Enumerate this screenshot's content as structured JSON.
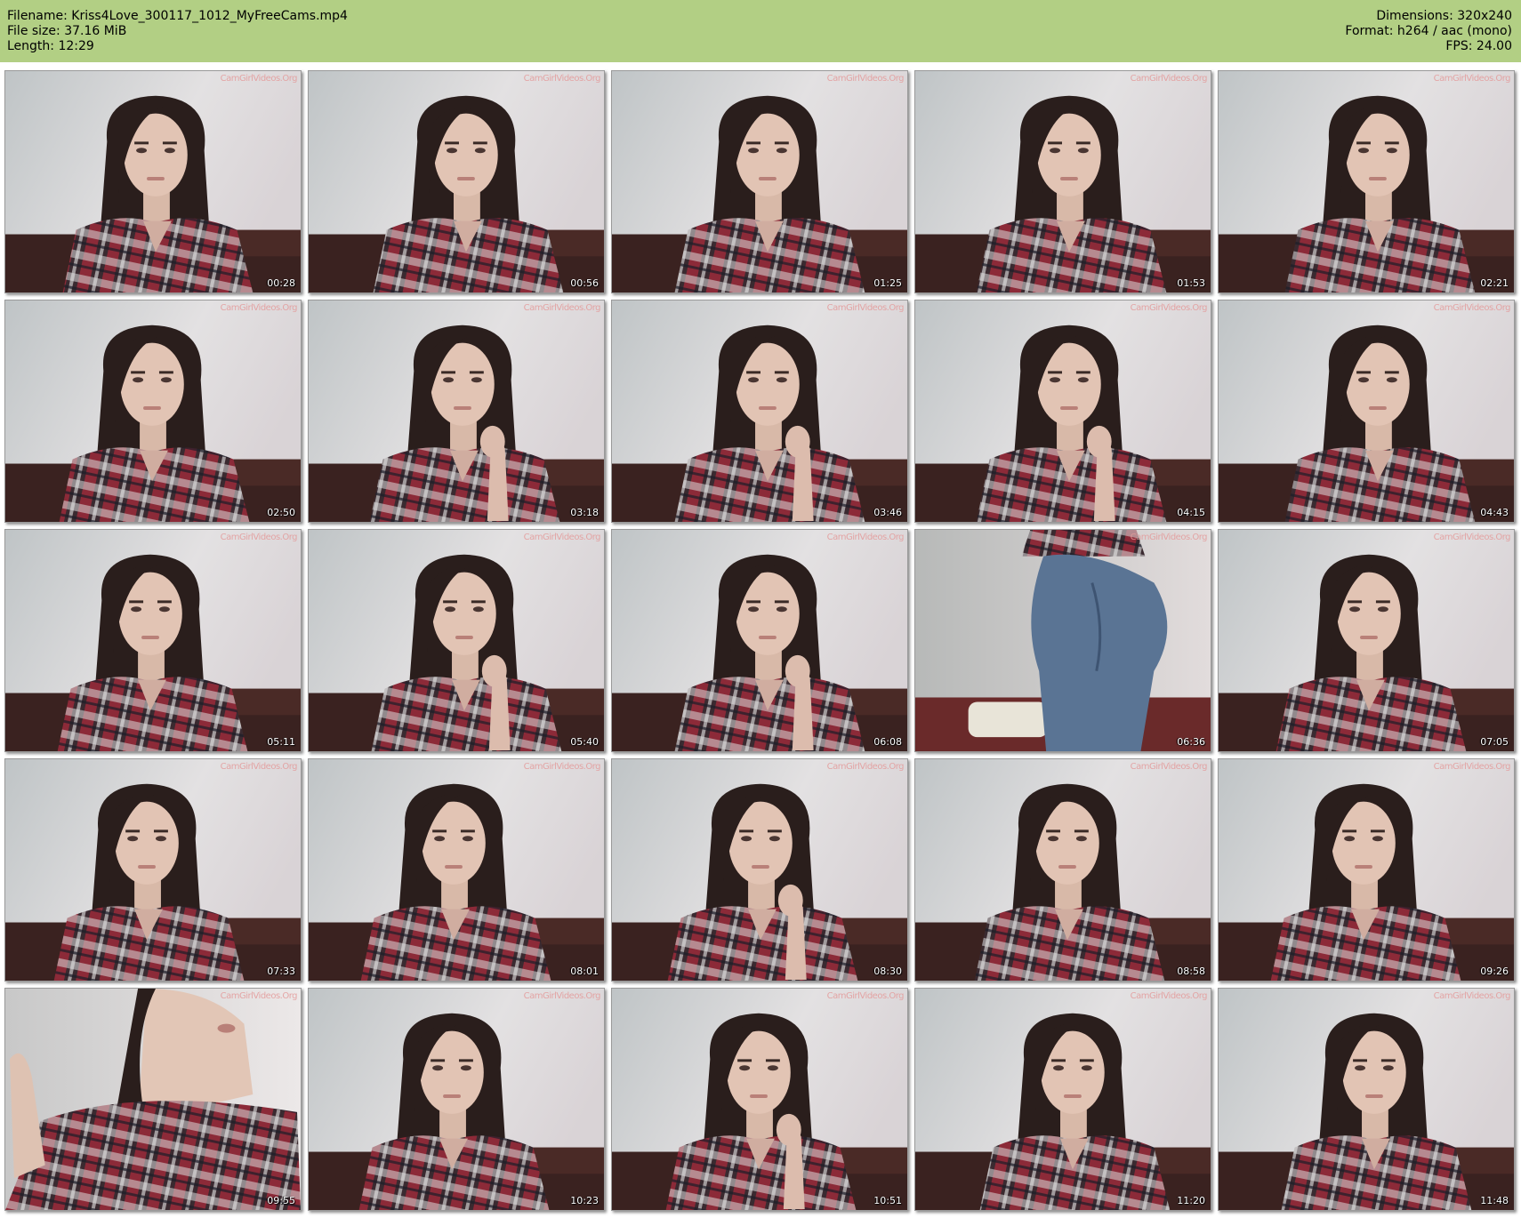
{
  "header": {
    "filename": "Filename: Kriss4Love_300117_1012_MyFreeCams.mp4",
    "filesize": "File size: 37.16 MiB",
    "length": "Length: 12:29",
    "dimensions": "Dimensions: 320x240",
    "format": "Format: h264 / aac (mono)",
    "fps": "FPS: 24.00"
  },
  "watermark": "CamGirlVideos.Org",
  "frames": [
    {
      "time": "00:28",
      "scene": "portrait"
    },
    {
      "time": "00:56",
      "scene": "portrait"
    },
    {
      "time": "01:25",
      "scene": "portrait"
    },
    {
      "time": "01:53",
      "scene": "portrait"
    },
    {
      "time": "02:21",
      "scene": "portrait"
    },
    {
      "time": "02:50",
      "scene": "portrait"
    },
    {
      "time": "03:18",
      "scene": "portrait-hand"
    },
    {
      "time": "03:46",
      "scene": "portrait-hand"
    },
    {
      "time": "04:15",
      "scene": "portrait-hand"
    },
    {
      "time": "04:43",
      "scene": "portrait"
    },
    {
      "time": "05:11",
      "scene": "portrait"
    },
    {
      "time": "05:40",
      "scene": "portrait-hand"
    },
    {
      "time": "06:08",
      "scene": "portrait-hand"
    },
    {
      "time": "06:36",
      "scene": "jeans"
    },
    {
      "time": "07:05",
      "scene": "portrait"
    },
    {
      "time": "07:33",
      "scene": "portrait"
    },
    {
      "time": "08:01",
      "scene": "portrait"
    },
    {
      "time": "08:30",
      "scene": "portrait-hand"
    },
    {
      "time": "08:58",
      "scene": "portrait"
    },
    {
      "time": "09:26",
      "scene": "portrait"
    },
    {
      "time": "09:55",
      "scene": "closeup"
    },
    {
      "time": "10:23",
      "scene": "portrait"
    },
    {
      "time": "10:51",
      "scene": "portrait-hand"
    },
    {
      "time": "11:20",
      "scene": "portrait"
    },
    {
      "time": "11:48",
      "scene": "portrait"
    }
  ]
}
